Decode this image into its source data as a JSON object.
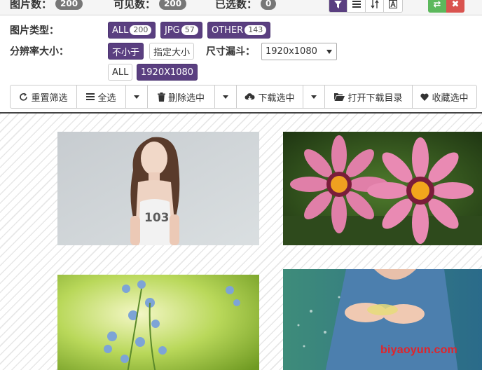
{
  "stats": {
    "total_label": "图片数：",
    "total_count": "200",
    "visible_label": "可见数：",
    "visible_count": "200",
    "selected_label": "已选数：",
    "selected_count": "0"
  },
  "view_buttons": [
    "filter-icon",
    "list-icon",
    "sort-icon",
    "az-icon"
  ],
  "window_controls": {
    "swap_glyph": "⇄",
    "close_glyph": "✖"
  },
  "filters": {
    "type_label": "图片类型：",
    "types": [
      {
        "label": "ALL",
        "count": "200"
      },
      {
        "label": "JPG",
        "count": "57"
      },
      {
        "label": "OTHER",
        "count": "143"
      }
    ],
    "resolution_label": "分辨率大小：",
    "res_modes": [
      "不小于",
      "指定大小"
    ],
    "size_funnel_label": "尺寸漏斗：",
    "size_select_value": "1920x1080",
    "res_values": [
      "ALL",
      "1920X1080"
    ]
  },
  "toolbar": {
    "reset": "重置筛选",
    "select_all": "全选",
    "delete_selected": "删除选中",
    "download_selected": "下载选中",
    "open_download_dir": "打开下载目录",
    "favorite_selected": "收藏选中"
  },
  "watermark": "biyaoyun.com",
  "colors": {
    "accent": "#5a3f80",
    "success": "#5cb85c",
    "danger": "#d9534f",
    "watermark": "#e0242a"
  }
}
